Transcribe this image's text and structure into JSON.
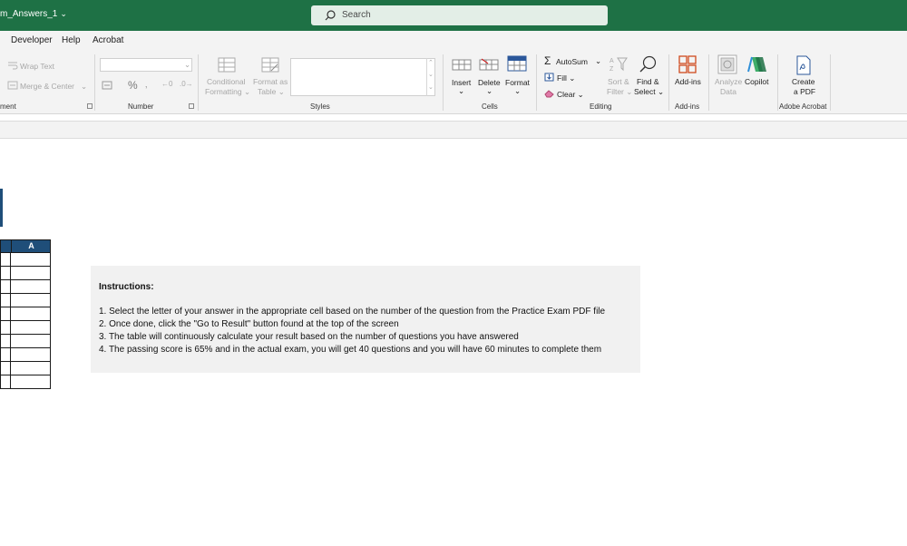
{
  "titlebar": {
    "doc_title": "m_Answers_1",
    "search_placeholder": "Search"
  },
  "menu": {
    "items": [
      "Developer",
      "Help",
      "Acrobat"
    ]
  },
  "ribbon": {
    "alignment": {
      "wrap_text": "Wrap Text",
      "merge_center": "Merge & Center",
      "label": "ment"
    },
    "number": {
      "percent": "%",
      "label": "Number"
    },
    "styles": {
      "conditional_formatting": [
        "Conditional",
        "Formatting"
      ],
      "format_as_table": [
        "Format as",
        "Table"
      ],
      "label": "Styles"
    },
    "cells": {
      "insert": "Insert",
      "delete": "Delete",
      "format": "Format",
      "label": "Cells"
    },
    "editing": {
      "autosum": "AutoSum",
      "fill": "Fill",
      "clear": "Clear",
      "sort_filter": [
        "Sort &",
        "Filter"
      ],
      "find_select": [
        "Find &",
        "Select"
      ],
      "label": "Editing"
    },
    "addins": {
      "addins": "Add-ins",
      "label": "Add-ins"
    },
    "analysis": {
      "analyze_data": [
        "Analyze",
        "Data"
      ],
      "copilot": "Copilot"
    },
    "acrobat": {
      "create_pdf": [
        "Create",
        "a PDF"
      ],
      "label": "Adobe Acrobat"
    }
  },
  "sheet": {
    "table": {
      "column_header": "A",
      "row_count": 10
    },
    "instructions": {
      "title": "Instructions:",
      "lines": [
        "1. Select the letter of your answer in the appropriate cell based on the number of the question from the Practice Exam PDF file",
        "2. Once done, click the \"Go to Result\" button found at the top of the screen",
        "3. The table will continuously calculate your result based on the number of questions you have answered",
        "4. The passing score is 65% and in the actual exam, you will get 40 questions and you will have 60 minutes to complete them"
      ]
    }
  },
  "colors": {
    "titlebar": "#1e7145",
    "table_header": "#1f4e79",
    "instructions_bg": "#f1f1f1"
  }
}
